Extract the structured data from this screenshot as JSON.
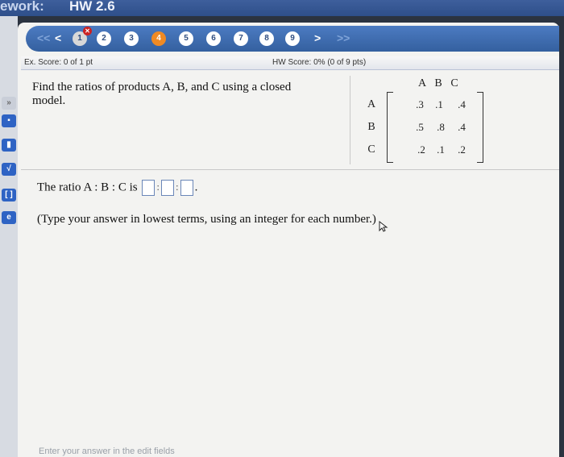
{
  "window": {
    "app_fragment": "ework:",
    "title": "HW 2.6"
  },
  "nav": {
    "first_label": "<<",
    "prev_label": "<",
    "next_label": ">",
    "last_label": ">>",
    "questions": [
      "1",
      "2",
      "3",
      "4",
      "5",
      "6",
      "7",
      "8",
      "9"
    ],
    "current_index": 4,
    "incorrect_marks": [
      "1"
    ]
  },
  "score": {
    "ex_score": "Ex. Score: 0 of 1 pt",
    "hw_score": "HW Score: 0% (0 of 9 pts)"
  },
  "question": {
    "text": "Find the ratios of products A, B, and C using a closed model."
  },
  "matrix": {
    "columns": [
      "A",
      "B",
      "C"
    ],
    "rows": [
      "A",
      "B",
      "C"
    ],
    "values": [
      [
        ".3",
        ".1",
        ".4"
      ],
      [
        ".5",
        ".8",
        ".4"
      ],
      [
        ".2",
        ".1",
        ".2"
      ]
    ]
  },
  "answer": {
    "prompt": "The ratio A : B : C is",
    "separator": ":",
    "end": "."
  },
  "hint": "(Type your answer in lowest terms, using an integer for each number.)",
  "footer": "Enter your answer in the edit fields"
}
